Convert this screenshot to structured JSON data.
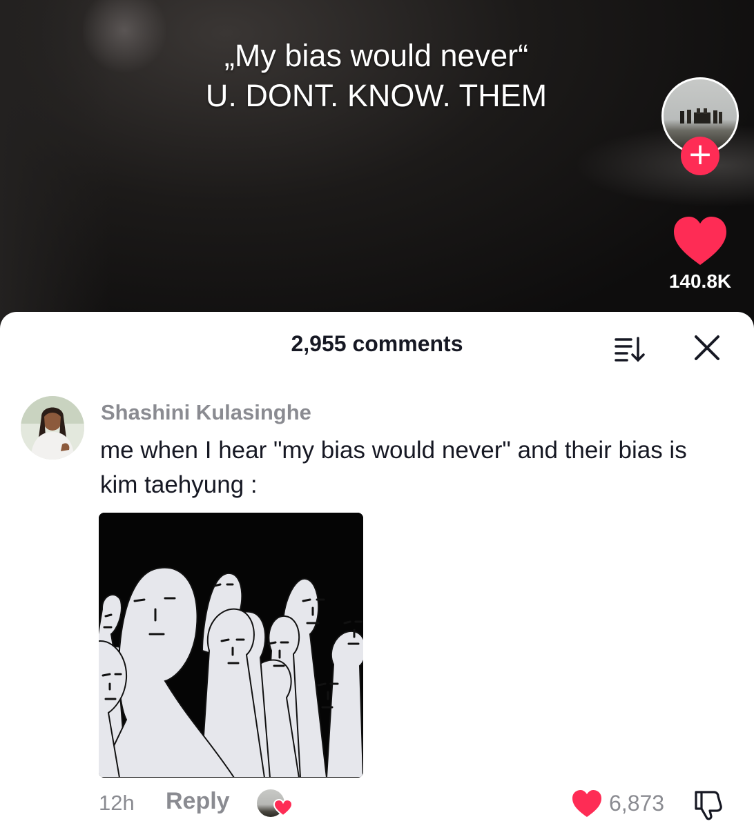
{
  "video": {
    "caption_line1": "„My bias would never“",
    "caption_line2": "U. DONT. KNOW. THEM",
    "like_count": "140.8K",
    "follow_symbol": "+"
  },
  "comments_panel": {
    "title": "2,955 comments"
  },
  "comment": {
    "username": "Shashini Kulasinghe",
    "text": "me when I hear \"my bias would never\" and their bias is kim taehyung :",
    "time": "12h",
    "reply_label": "Reply",
    "like_count": "6,873",
    "liked_by_creator": true
  },
  "colors": {
    "accent": "#fe2c55",
    "text_primary": "#161823",
    "text_secondary": "#8a8b91"
  },
  "icons": [
    "plus-icon",
    "heart-icon",
    "sort-icon",
    "close-icon",
    "dislike-icon"
  ]
}
